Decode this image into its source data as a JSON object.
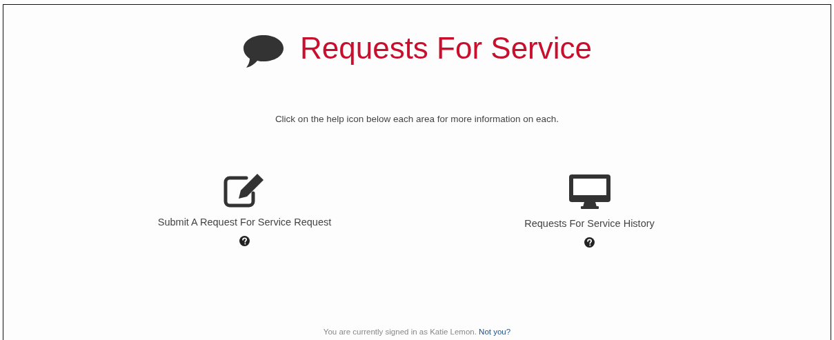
{
  "header": {
    "title": "Requests For Service"
  },
  "intro": "Click on the help icon below each area for more information on each.",
  "options": [
    {
      "kind": "edit",
      "label": "Submit A Request For Service Request"
    },
    {
      "kind": "monitor",
      "label": "Requests For Service History"
    }
  ],
  "footer": {
    "text": "You are currently signed in as Katie Lemon.",
    "link": "Not you?"
  }
}
